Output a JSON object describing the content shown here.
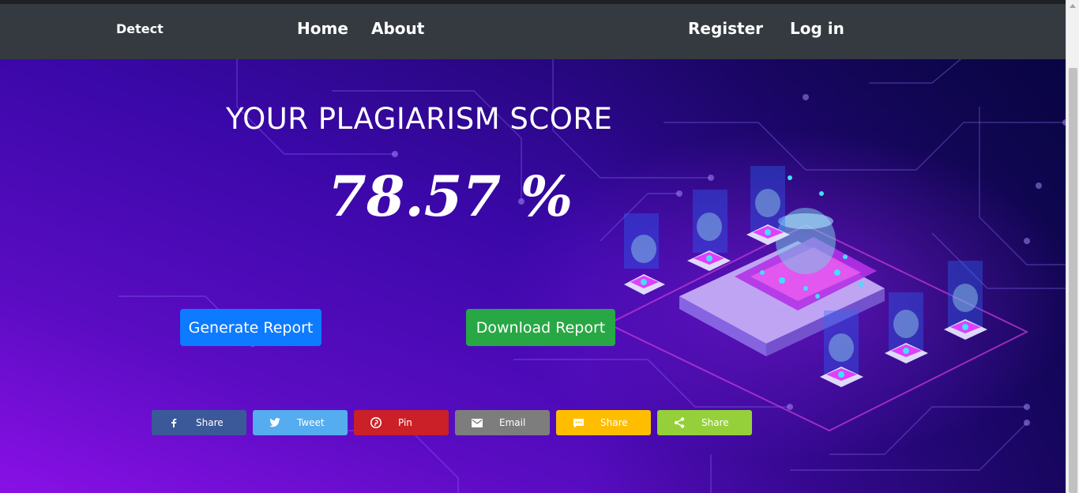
{
  "navbar": {
    "brand": "Detect",
    "links": [
      "Home",
      "About"
    ],
    "auth": [
      "Register",
      "Log in"
    ]
  },
  "score": {
    "title": "YOUR PLAGIARISM SCORE",
    "value": "78.57 %"
  },
  "buttons": {
    "generate": "Generate Report",
    "download": "Download Report"
  },
  "share": [
    {
      "label": "Share",
      "icon": "facebook-icon",
      "color": "#3b5998"
    },
    {
      "label": "Tweet",
      "icon": "twitter-icon",
      "color": "#55acee"
    },
    {
      "label": "Pin",
      "icon": "pinterest-icon",
      "color": "#cb2027"
    },
    {
      "label": "Email",
      "icon": "email-icon",
      "color": "#7d7d7d"
    },
    {
      "label": "Share",
      "icon": "sms-icon",
      "color": "#ffbd00"
    },
    {
      "label": "Share",
      "icon": "sharethis-icon",
      "color": "#95d03a"
    }
  ],
  "colors": {
    "navbar": "#343a40",
    "primary": "#0d7bff",
    "success": "#28a745"
  }
}
